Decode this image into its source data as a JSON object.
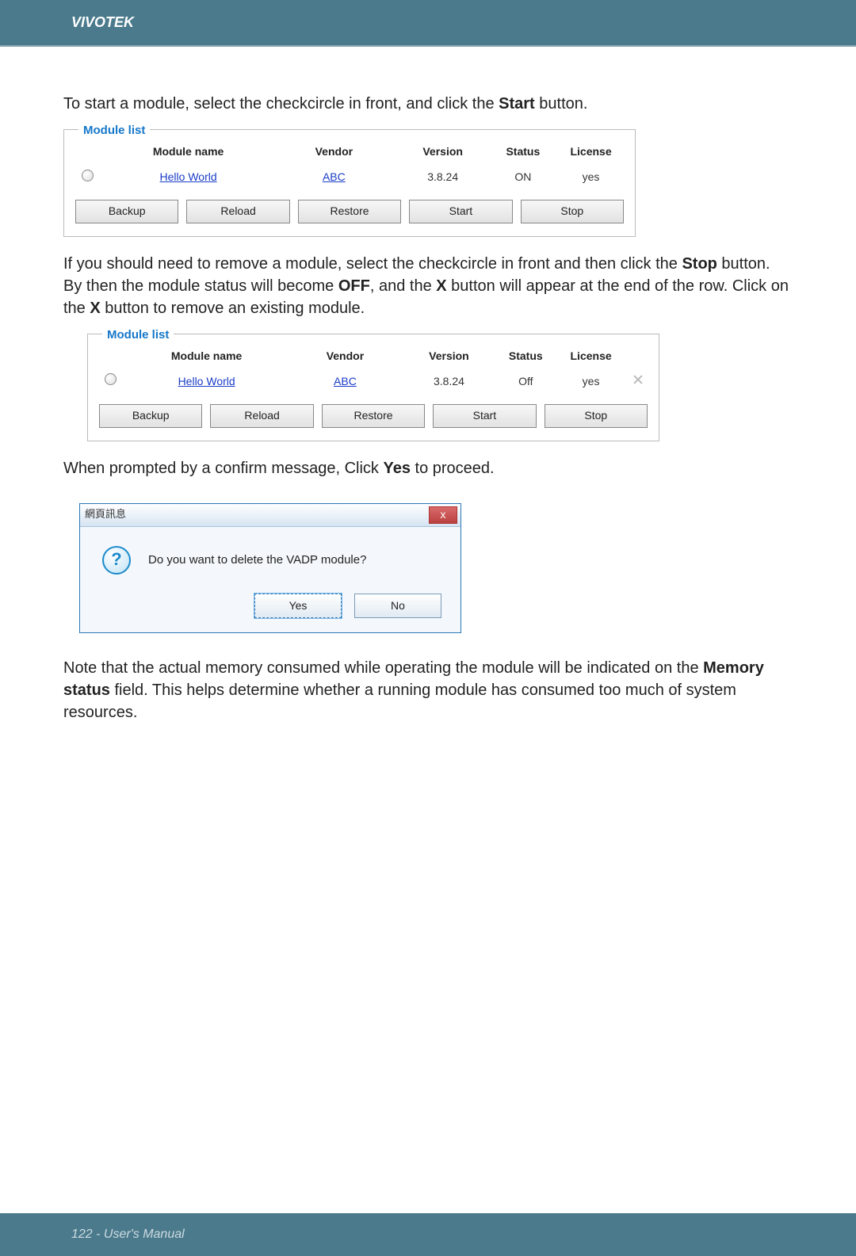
{
  "header": {
    "brand": "VIVOTEK"
  },
  "text": {
    "intro_a": "To start a module, select the checkcircle in front, and click the ",
    "intro_b": " button.",
    "para2_a": "If you should need to remove a module, select the checkcircle in front and then click the ",
    "para2_b": " button. By then the module status will become ",
    "para2_c": ", and the ",
    "para2_d": " button will appear at the end of the row. Click on the ",
    "para2_e": " button to remove an existing module.",
    "para3_a": "When prompted by a confirm message, Click ",
    "para3_b": " to proceed.",
    "para4_a": "Note that the actual memory consumed while operating the module will be indicated on the ",
    "para4_b": " field. This helps determine whether a running module has consumed too much of system resources.",
    "bold": {
      "start": "Start",
      "stop": "Stop",
      "off": "OFF",
      "x": "X",
      "yes": "Yes",
      "memory_status": "Memory status"
    }
  },
  "module_list": {
    "legend": "Module list",
    "headers": {
      "name": "Module name",
      "vendor": "Vendor",
      "version": "Version",
      "status": "Status",
      "license": "License"
    },
    "buttons": {
      "backup": "Backup",
      "reload": "Reload",
      "restore": "Restore",
      "start": "Start",
      "stop": "Stop"
    }
  },
  "module1": {
    "name": "Hello World",
    "vendor": "ABC",
    "version": "3.8.24",
    "status": "ON",
    "license": "yes"
  },
  "module2": {
    "name": "Hello World",
    "vendor": "ABC",
    "version": "3.8.24",
    "status": "Off",
    "license": "yes"
  },
  "dialog": {
    "title": "網頁訊息",
    "message": "Do you want to delete the VADP module?",
    "yes": "Yes",
    "no": "No",
    "close": "x"
  },
  "footer": {
    "page": "122",
    "sep": " - ",
    "label": "User's Manual"
  }
}
